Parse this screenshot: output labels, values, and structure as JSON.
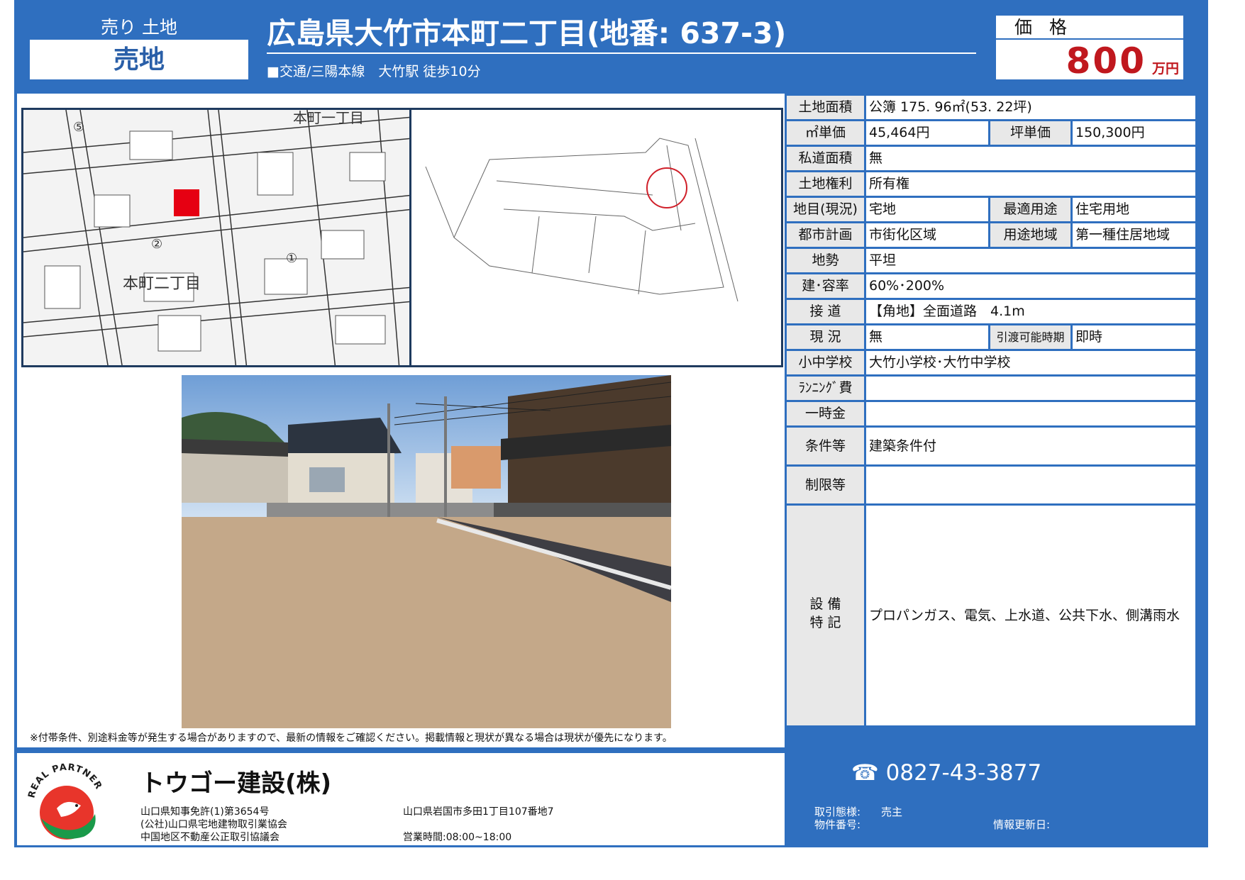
{
  "header": {
    "category_top": "売り 土地",
    "category_main": "売地",
    "title": "広島県大竹市本町二丁目(地番: 637-3)",
    "access": "■交通/三陽本線　大竹駅 徒歩10分",
    "price_label": "価 格",
    "price_value": "800",
    "price_unit": "万円"
  },
  "maps": {
    "area_label_1": "本町一丁目",
    "area_label_2": "本町二丁目",
    "circle_1": "①",
    "circle_2": "②",
    "circle_5": "⑤"
  },
  "note": "※付帯条件、別途料金等が発生する場合がありますので、最新の情報をご確認ください。掲載情報と現状が異なる場合は現状が優先になります。",
  "table": {
    "land_area_label": "土地面積",
    "land_area_value": "公簿 175. 96㎡(53. 22坪)",
    "sqm_price_label": "㎡単価",
    "sqm_price_value": "45,464円",
    "tsubo_price_label": "坪単価",
    "tsubo_price_value": "150,300円",
    "private_road_label": "私道面積",
    "private_road_value": "無",
    "land_right_label": "土地権利",
    "land_right_value": "所有権",
    "land_category_label": "地目(現況)",
    "land_category_value": "宅地",
    "best_use_label": "最適用途",
    "best_use_value": "住宅用地",
    "city_plan_label": "都市計画",
    "city_plan_value": "市街化区域",
    "zoning_label": "用途地域",
    "zoning_value": "第一種住居地域",
    "terrain_label": "地勢",
    "terrain_value": "平坦",
    "coverage_label": "建･容率",
    "coverage_value": "60%･200%",
    "road_label": "接 道",
    "road_value": "【角地】全面道路　4.1m",
    "status_label": "現 況",
    "status_value": "無",
    "handover_label": "引渡可能時期",
    "handover_value": "即時",
    "school_label": "小中学校",
    "school_value": "大竹小学校･大竹中学校",
    "running_cost_label": "ﾗﾝﾆﾝｸﾞ費",
    "running_cost_value": "",
    "lump_sum_label": "一時金",
    "lump_sum_value": "",
    "conditions_label": "条件等",
    "conditions_value": "建築条件付",
    "restrictions_label": "制限等",
    "restrictions_value": "",
    "facilities_label_1": "設 備",
    "facilities_label_2": "特 記",
    "facilities_value": "プロパンガス、電気、上水道、公共下水、側溝雨水"
  },
  "footer": {
    "company": "トウゴー建設(株)",
    "logo_text": "REAL PARTNER",
    "license_1": "山口県知事免許(1)第3654号",
    "license_2": "(公社)山口県宅地建物取引業協会",
    "license_3": "中国地区不動産公正取引協議会",
    "address": "山口県岩国市多田1丁目107番地7",
    "hours": "営業時間:08:00~18:00",
    "phone": "0827-43-3877",
    "transaction_label": "取引態様:",
    "transaction_value": "売主",
    "property_id_label": "物件番号:",
    "update_label": "情報更新日:"
  },
  "colors": {
    "frame_blue": "#2f6fbf",
    "price_red": "#c0181e",
    "marker_red": "#e60012",
    "label_gray": "#e8e8e8"
  }
}
